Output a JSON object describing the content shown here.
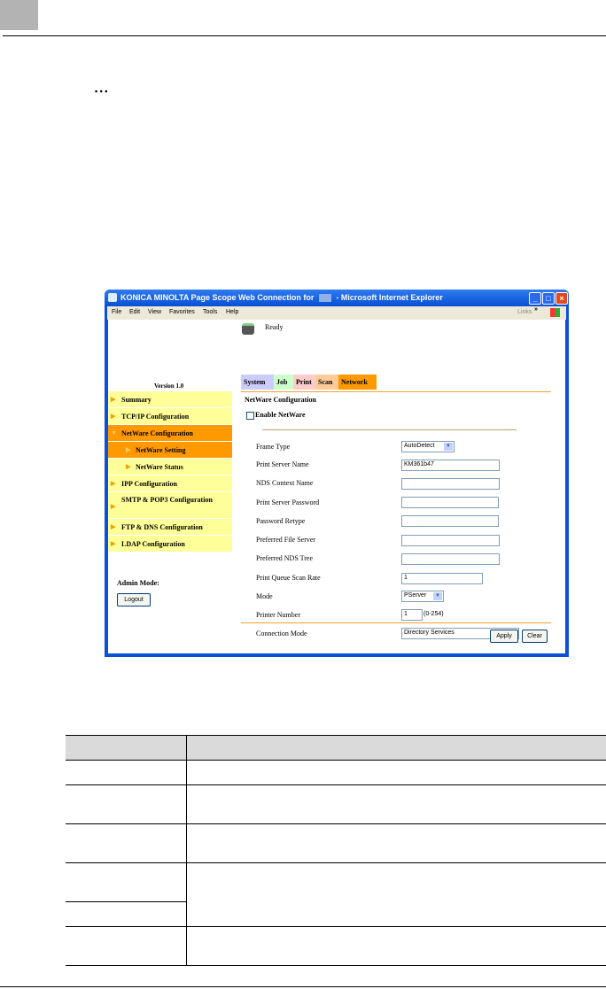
{
  "page": {
    "bullet": "• • •"
  },
  "browser": {
    "title": "KONICA MINOLTA Page Scope Web Connection for",
    "title_suffix": "- Microsoft Internet Explorer",
    "menu": [
      "File",
      "Edit",
      "View",
      "Favorites",
      "Tools",
      "Help"
    ],
    "links_label": "Links",
    "links_chevron": "»"
  },
  "app": {
    "status": "Ready",
    "version": "Version 1.0",
    "tabs": [
      {
        "label": "System",
        "color": "#ccccff"
      },
      {
        "label": "Job",
        "color": "#ccffcc"
      },
      {
        "label": "Print",
        "color": "#ffcccc"
      },
      {
        "label": "Scan",
        "color": "#ffcc99"
      },
      {
        "label": "Network",
        "color": "#ff9900",
        "active": true
      }
    ],
    "sidebar": [
      {
        "label": "Summary"
      },
      {
        "label": "TCP/IP Configuration"
      },
      {
        "label": "NetWare Configuration",
        "selected": true,
        "expanded": true
      },
      {
        "label": "NetWare Setting",
        "selected": true,
        "sub": true
      },
      {
        "label": "NetWare Status",
        "sub": true
      },
      {
        "label": "IPP Configuration"
      },
      {
        "label": "SMTP & POP3 Configuration"
      },
      {
        "label": "FTP & DNS Configuration"
      },
      {
        "label": "LDAP Configuration"
      }
    ],
    "admin_mode": "Admin Mode:",
    "logout": "Logout",
    "form": {
      "title": "NetWare Configuration",
      "enable_label": "Enable NetWare",
      "enable_checked": false,
      "fields": [
        {
          "label": "Frame Type",
          "type": "select",
          "value": "AutoDetect"
        },
        {
          "label": "Print Server Name",
          "type": "text",
          "value": "KM361b47"
        },
        {
          "label": "NDS Context Name",
          "type": "text",
          "value": ""
        },
        {
          "label": "Print Server Password",
          "type": "text",
          "value": ""
        },
        {
          "label": "Password Retype",
          "type": "text",
          "value": ""
        },
        {
          "label": "Preferred File Server",
          "type": "text",
          "value": ""
        },
        {
          "label": "Preferred NDS Tree",
          "type": "text",
          "value": ""
        },
        {
          "label": "Print Queue Scan Rate",
          "type": "text",
          "value": "1"
        },
        {
          "label": "Mode",
          "type": "select",
          "value": "PServer"
        },
        {
          "label": "Printer Number",
          "type": "text",
          "value": "1",
          "hint": "(0-254)"
        },
        {
          "label": "Connection Mode",
          "type": "select",
          "value": "Directory Services"
        }
      ],
      "apply": "Apply",
      "clear": "Clear"
    }
  },
  "table": {
    "rows": 6
  }
}
